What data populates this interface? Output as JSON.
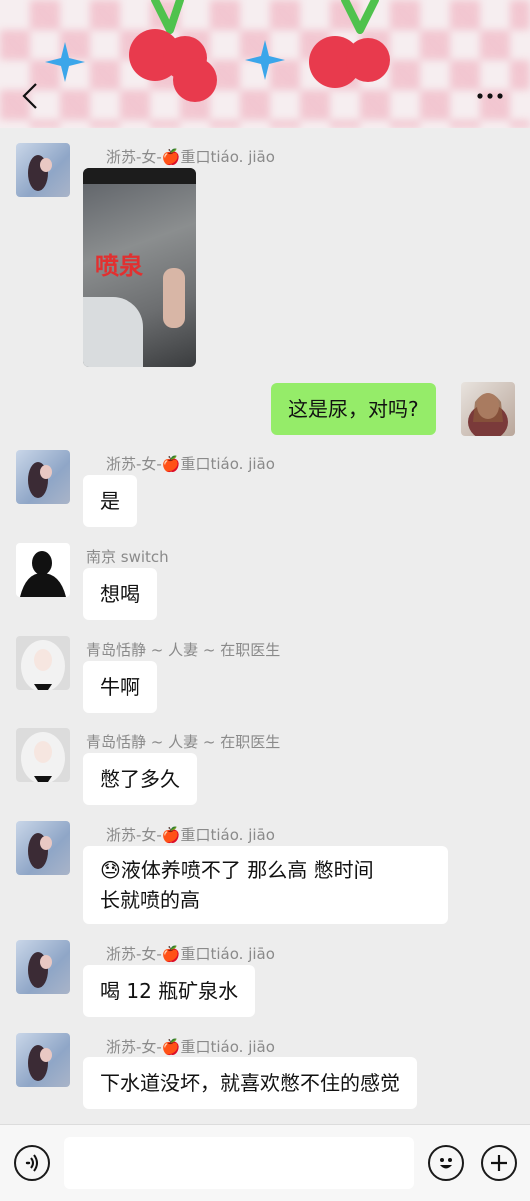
{
  "header": {
    "back_icon": "chevron-left-icon",
    "more_icon": "ellipsis-icon",
    "banner_colors": [
      "#f2a3b4",
      "#e83a4d",
      "#4fc24d",
      "#3ba6ea"
    ]
  },
  "messages": [
    {
      "sender": "浙苏-女-🍎重口tiáo. jiāo",
      "type": "image",
      "image_caption": "喷泉"
    },
    {
      "sender": "",
      "type": "text",
      "text": "这是尿，对吗?",
      "self": true
    },
    {
      "sender": "浙苏-女-🍎重口tiáo. jiāo",
      "type": "text",
      "text": "是"
    },
    {
      "sender": "南京 switch",
      "type": "text",
      "text": "想喝"
    },
    {
      "sender": "青岛恬静 ~ 人妻 ~ 在职医生",
      "type": "text",
      "text": "牛啊"
    },
    {
      "sender": "青岛恬静 ~ 人妻 ~ 在职医生",
      "type": "text",
      "text": "憋了多久"
    },
    {
      "sender": "浙苏-女-🍎重口tiáo. jiāo",
      "type": "text",
      "line1": "液体养喷不了  那么高     憋时间",
      "line2": "长就喷的高",
      "emoji": "😓"
    },
    {
      "sender": "浙苏-女-🍎重口tiáo. jiāo",
      "type": "text",
      "text": "喝 12 瓶矿泉水"
    },
    {
      "sender": "浙苏-女-🍎重口tiáo. jiāo",
      "type": "text",
      "text": "下水道没坏，就喜欢憋不住的感觉"
    }
  ],
  "input_bar": {
    "voice_icon": "voice-icon",
    "emoji_icon": "emoji-icon",
    "plus_icon": "plus-icon",
    "value": ""
  }
}
